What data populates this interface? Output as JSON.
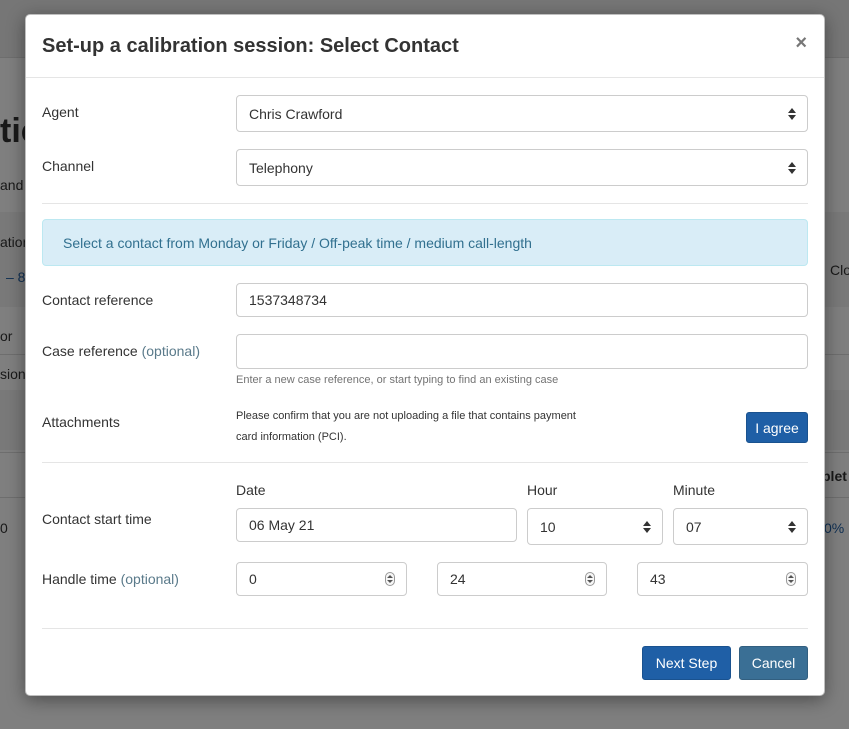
{
  "background": {
    "title_fragment": "tic",
    "text_and": "and",
    "text_ation": "ation",
    "text_range": "– 8",
    "text_clo": "Clo",
    "text_or": "or",
    "text_sion": "sion",
    "text_plet": "plet",
    "text_zero": "0",
    "text_percent": "0%"
  },
  "modal": {
    "title": "Set-up a calibration session: Select Contact",
    "close_glyph": "×",
    "agent": {
      "label": "Agent",
      "value": "Chris Crawford"
    },
    "channel": {
      "label": "Channel",
      "value": "Telephony"
    },
    "alert": "Select a contact from Monday or Friday / Off-peak time / medium call-length",
    "contact_reference": {
      "label": "Contact reference",
      "value": "1537348734"
    },
    "case_reference": {
      "label": "Case reference",
      "optional": "(optional)",
      "value": "",
      "help": "Enter a new case reference, or start typing to find an existing case"
    },
    "attachments": {
      "label": "Attachments",
      "notice_line1": "Please confirm that you are not uploading a file that contains payment",
      "notice_line2": "card information (PCI).",
      "agree_button": "I agree"
    },
    "contact_start_time": {
      "label": "Contact start time",
      "date_header": "Date",
      "hour_header": "Hour",
      "minute_header": "Minute",
      "date": "06 May 21",
      "hour": "10",
      "minute": "07"
    },
    "handle_time": {
      "label": "Handle time",
      "optional": "(optional)",
      "hours": "0",
      "minutes": "24",
      "seconds": "43"
    },
    "footer": {
      "next_button": "Next Step",
      "cancel_button": "Cancel"
    }
  }
}
